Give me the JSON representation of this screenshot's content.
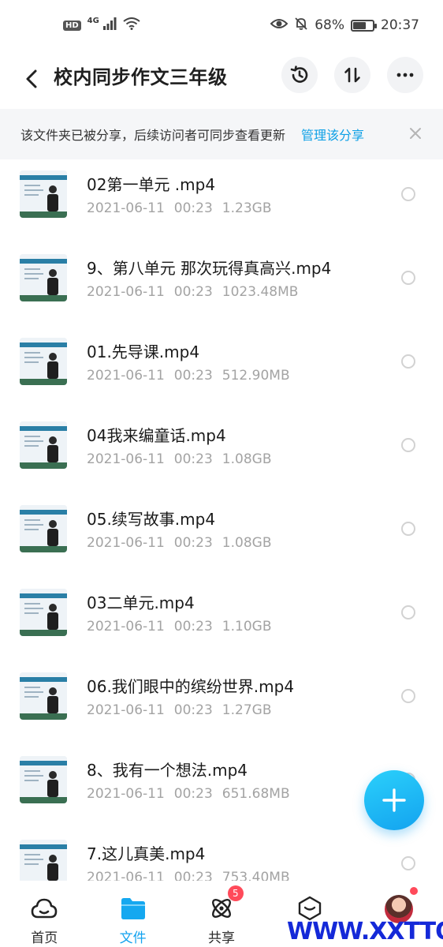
{
  "status_bar": {
    "hd": "HD",
    "network": "4G",
    "battery": "68%",
    "battery_level": 0.68,
    "time": "20:37"
  },
  "header": {
    "title": "校内同步作文三年级",
    "icons": [
      "back-icon",
      "history-icon",
      "sort-icon",
      "more-icon"
    ]
  },
  "share_banner": {
    "text": "该文件夹已被分享，后续访问者可同步查看更新",
    "link": "管理该分享"
  },
  "files": [
    {
      "name": "02第一单元 .mp4",
      "date": "2021-06-11",
      "time": "00:23",
      "size": "1.23GB"
    },
    {
      "name": "9、第八单元 那次玩得真高兴.mp4",
      "date": "2021-06-11",
      "time": "00:23",
      "size": "1023.48MB"
    },
    {
      "name": "01.先导课.mp4",
      "date": "2021-06-11",
      "time": "00:23",
      "size": "512.90MB"
    },
    {
      "name": "04我来编童话.mp4",
      "date": "2021-06-11",
      "time": "00:23",
      "size": "1.08GB"
    },
    {
      "name": "05.续写故事.mp4",
      "date": "2021-06-11",
      "time": "00:23",
      "size": "1.08GB"
    },
    {
      "name": "03二单元.mp4",
      "date": "2021-06-11",
      "time": "00:23",
      "size": "1.10GB"
    },
    {
      "name": "06.我们眼中的缤纷世界.mp4",
      "date": "2021-06-11",
      "time": "00:23",
      "size": "1.27GB"
    },
    {
      "name": "8、我有一个想法.mp4",
      "date": "2021-06-11",
      "time": "00:23",
      "size": "651.68MB"
    },
    {
      "name": "7.这儿真美.mp4",
      "date": "2021-06-11",
      "time": "00:23",
      "size": "753.40MB"
    }
  ],
  "bottom_nav": {
    "items": [
      {
        "label": "首页",
        "icon": "home-cloud-icon"
      },
      {
        "label": "文件",
        "icon": "folder-icon",
        "active": true
      },
      {
        "label": "共享",
        "icon": "share-atom-icon",
        "badge": "5"
      },
      {
        "label": "",
        "icon": "discover-icon"
      },
      {
        "label": "",
        "icon": "avatar"
      }
    ]
  },
  "watermark": "WWW.XXTTQ.COM",
  "colors": {
    "accent": "#13a3ef",
    "link": "#0ea0e6",
    "badge": "#ff4a5a",
    "watermark": "#1429d8"
  }
}
